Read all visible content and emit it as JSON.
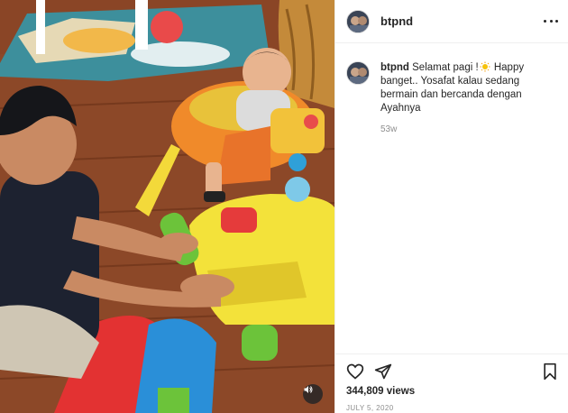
{
  "media": {
    "description_icon": "video-frame",
    "mute_icon": "speaker-icon"
  },
  "post": {
    "username": "btpnd",
    "caption_part1": "Selamat pagi !",
    "caption_emoji": "sun-emoji",
    "caption_part2": "Happy banget.. Yosafat kalau sedang bermain dan bercanda dengan Ayahnya",
    "time_ago": "53w",
    "views": "344,809 views",
    "date": "JULY 5, 2020"
  },
  "colors": {
    "text": "#262626",
    "muted": "#8e8e8e",
    "border": "#efefef"
  }
}
